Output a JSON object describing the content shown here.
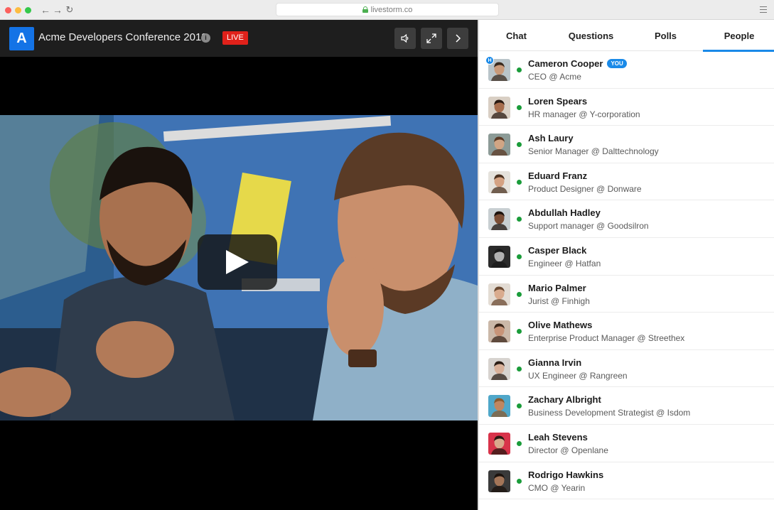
{
  "browser": {
    "url": "livestorm.co",
    "traffic_colors": [
      "#fc605c",
      "#fdbc40",
      "#34c84a"
    ]
  },
  "header": {
    "logo_letter": "A",
    "title": "Acme Developers Conference 2018",
    "live_label": "LIVE",
    "icons": [
      "speaker-icon",
      "fullscreen-icon",
      "chevron-right-icon"
    ]
  },
  "video": {
    "state": "paused",
    "icon": "play-icon"
  },
  "tabs": [
    {
      "label": "Chat"
    },
    {
      "label": "Questions"
    },
    {
      "label": "Polls"
    },
    {
      "label": "People",
      "active": true
    }
  ],
  "people": [
    {
      "name": "Cameron Cooper",
      "role": "CEO @ Acme",
      "you_label": "YOU",
      "host_label": "H",
      "skin": "#c99a7a",
      "hair": "#3a2a1e",
      "bg": "#b9c4c9"
    },
    {
      "name": "Loren Spears",
      "role": "HR manager @ Y-corporation",
      "skin": "#a86e4e",
      "hair": "#2a1a12",
      "bg": "#d9cfc4"
    },
    {
      "name": "Ash Laury",
      "role": "Senior Manager @ Dalttechnology",
      "skin": "#d1a584",
      "hair": "#5b3a25",
      "bg": "#8c9b97"
    },
    {
      "name": "Eduard Franz",
      "role": "Product Designer @ Donware",
      "skin": "#d4a283",
      "hair": "#4a3120",
      "bg": "#e5e2dc"
    },
    {
      "name": "Abdullah Hadley",
      "role": "Support manager @ Goodsilron",
      "skin": "#7b4e36",
      "hair": "#1c120c",
      "bg": "#c8cfd2"
    },
    {
      "name": "Casper Black",
      "role": "Engineer @ Hatfan",
      "skin": "#b0b0b0",
      "hair": "#1a1a1a",
      "bg": "#2a2a2a"
    },
    {
      "name": "Mario Palmer",
      "role": "Jurist @ Finhigh",
      "skin": "#d9ab8e",
      "hair": "#6b4a32",
      "bg": "#e3dcd4"
    },
    {
      "name": "Olive Mathews",
      "role": "Enterprise Product Manager @ Streethex",
      "skin": "#c89478",
      "hair": "#3b2619",
      "bg": "#cbb8a8"
    },
    {
      "name": "Gianna Irvin",
      "role": "UX Engineer @ Rangreen",
      "skin": "#d8b099",
      "hair": "#2b1d15",
      "bg": "#d7d3cf"
    },
    {
      "name": "Zachary Albright",
      "role": "Business Development Strategist @ Isdom",
      "skin": "#c08660",
      "hair": "#8a5a2e",
      "bg": "#4fa7c9"
    },
    {
      "name": "Leah Stevens",
      "role": "Director @ Openlane",
      "skin": "#d9a88c",
      "hair": "#2a1812",
      "bg": "#d8334a"
    },
    {
      "name": "Rodrigo Hawkins",
      "role": "CMO @ Yearin",
      "skin": "#a37558",
      "hair": "#1c130e",
      "bg": "#3a3a3a"
    }
  ]
}
